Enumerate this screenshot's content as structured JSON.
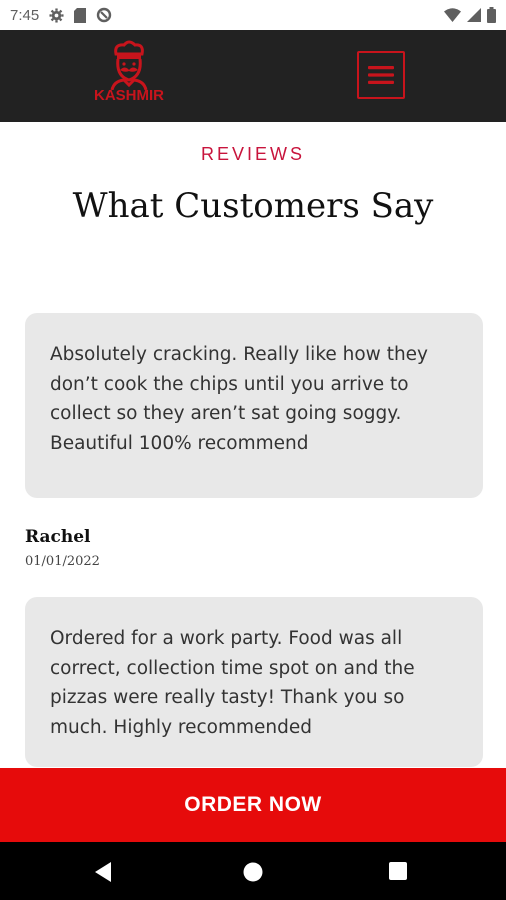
{
  "status_bar": {
    "time": "7:45",
    "icons": [
      "gear-icon",
      "sd-card-icon",
      "data-saver-icon",
      "wifi-icon",
      "cell-signal-icon",
      "battery-icon"
    ]
  },
  "header": {
    "logo_text": "KASHMIR",
    "menu_icon": "hamburger-menu-icon",
    "accent_color": "#c8141c"
  },
  "reviews_section": {
    "eyebrow": "REVIEWS",
    "title": "What Customers Say",
    "reviews": [
      {
        "text": "Absolutely cracking. Really like how they don’t cook the chips until you arrive to collect so they aren’t sat going soggy. Beautiful 100% recommend",
        "author": "Rachel",
        "date": "01/01/2022"
      },
      {
        "text": "Ordered for a work party. Food was all correct, collection time spot on and the pizzas were really tasty! Thank you so much. Highly recommended"
      }
    ]
  },
  "order_bar": {
    "label": "ORDER NOW",
    "color": "#e60b0b"
  },
  "nav_bar": {
    "icons": [
      "back-icon",
      "home-icon",
      "recents-icon"
    ]
  }
}
